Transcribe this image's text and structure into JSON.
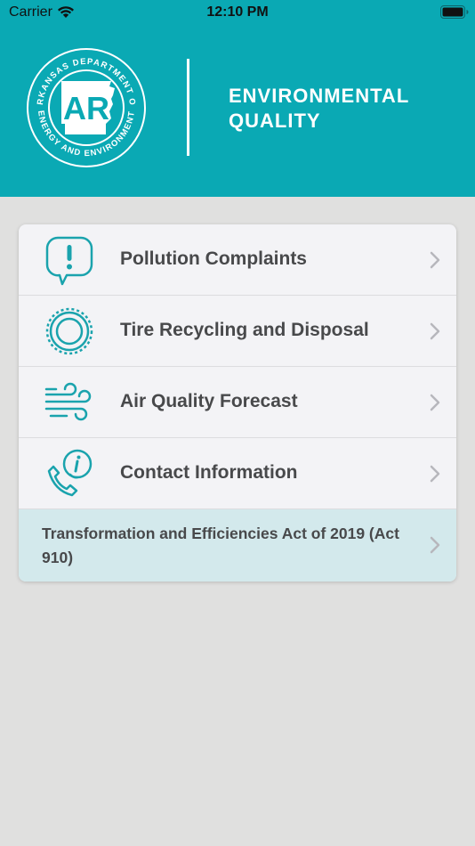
{
  "status_bar": {
    "carrier": "Carrier",
    "time": "12:10 PM"
  },
  "header": {
    "seal_text_top": "ARKANSAS DEPARTMENT OF",
    "seal_text_bottom": "ENERGY AND ENVIRONMENT",
    "seal_logo": "AR",
    "brand_line1": "ENVIRONMENTAL",
    "brand_line2": "QUALITY",
    "background_color": "#0aa9b4"
  },
  "menu": {
    "items": [
      {
        "label": "Pollution Complaints",
        "icon": "alert-bubble-icon"
      },
      {
        "label": "Tire Recycling and Disposal",
        "icon": "tire-icon"
      },
      {
        "label": "Air Quality Forecast",
        "icon": "wind-icon"
      },
      {
        "label": "Contact Information",
        "icon": "phone-info-icon"
      }
    ],
    "act_item": {
      "label": "Transformation and Efficiencies Act of 2019 (Act 910)"
    },
    "icon_color": "#1aa3ad",
    "act_background": "#d3e9ec"
  }
}
